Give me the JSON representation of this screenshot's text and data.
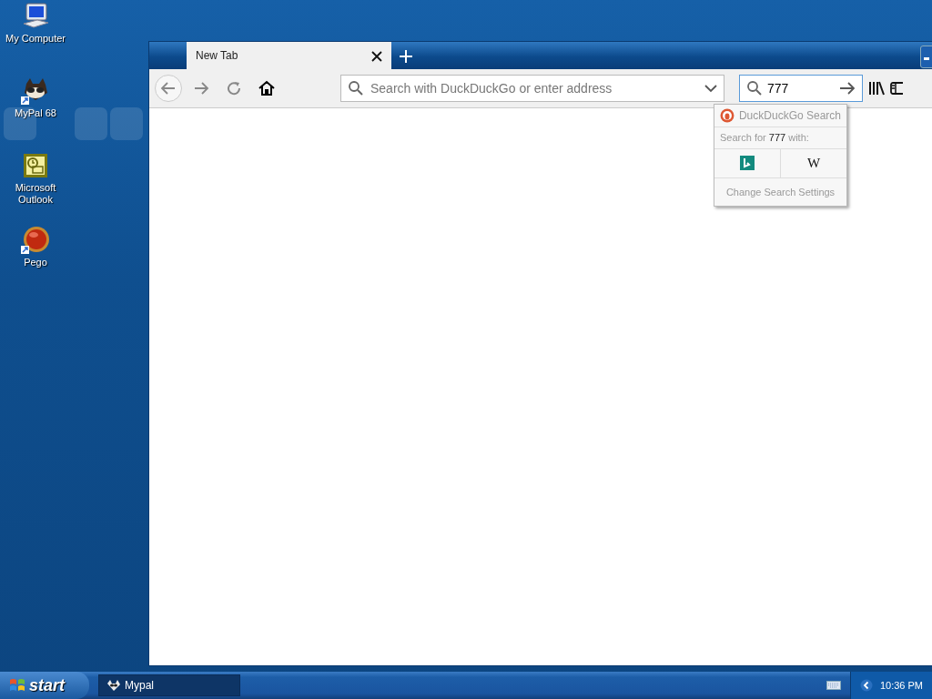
{
  "desktop_icons": [
    {
      "kind": "computer",
      "label": "My Computer"
    },
    {
      "kind": "raccoon",
      "label": "MyPal 68"
    },
    {
      "kind": "outlook",
      "label": "Microsoft Outlook"
    },
    {
      "kind": "orb",
      "label": "Pego"
    }
  ],
  "browser": {
    "tabs": [
      {
        "label": "New Tab",
        "selected": true
      }
    ],
    "address_bar": {
      "placeholder": "Search with DuckDuckGo or enter address"
    },
    "search_box": {
      "value": "777"
    },
    "search_popup": {
      "engine": "DuckDuckGo Search",
      "prefix": "Search for",
      "term": "777",
      "suffix": "with:",
      "engines": [
        {
          "kind": "bing"
        },
        {
          "kind": "wikipedia",
          "label": "W"
        }
      ],
      "settings": "Change Search Settings"
    }
  },
  "taskbar": {
    "start": "start",
    "tasks": [
      {
        "label": "Mypal",
        "selected": true
      }
    ],
    "clock": "10:36 PM"
  }
}
